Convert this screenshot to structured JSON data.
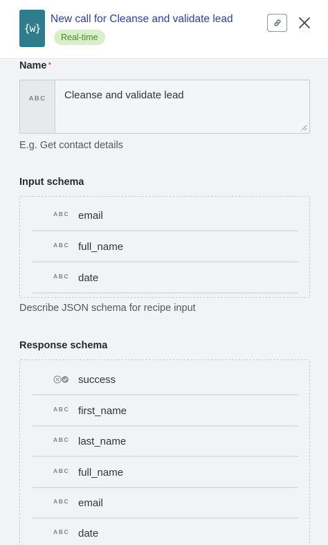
{
  "header": {
    "logo_text": "{w}",
    "title": "New call for Cleanse and validate lead",
    "badge": "Real-time",
    "accent": "#2e7c8c"
  },
  "name_field": {
    "label": "Name",
    "required_marker": "*",
    "type_tag": "ABC",
    "value": "Cleanse and validate lead",
    "hint": "E.g. Get contact details"
  },
  "input_schema": {
    "label": "Input schema",
    "fields": [
      {
        "type": "ABC",
        "name": "email"
      },
      {
        "type": "ABC",
        "name": "full_name"
      },
      {
        "type": "ABC",
        "name": "date"
      }
    ],
    "hint": "Describe JSON schema for recipe input"
  },
  "response_schema": {
    "label": "Response schema",
    "fields": [
      {
        "type": "boolean-icon",
        "name": "success"
      },
      {
        "type": "ABC",
        "name": "first_name"
      },
      {
        "type": "ABC",
        "name": "last_name"
      },
      {
        "type": "ABC",
        "name": "full_name"
      },
      {
        "type": "ABC",
        "name": "email"
      },
      {
        "type": "ABC",
        "name": "date"
      }
    ]
  }
}
